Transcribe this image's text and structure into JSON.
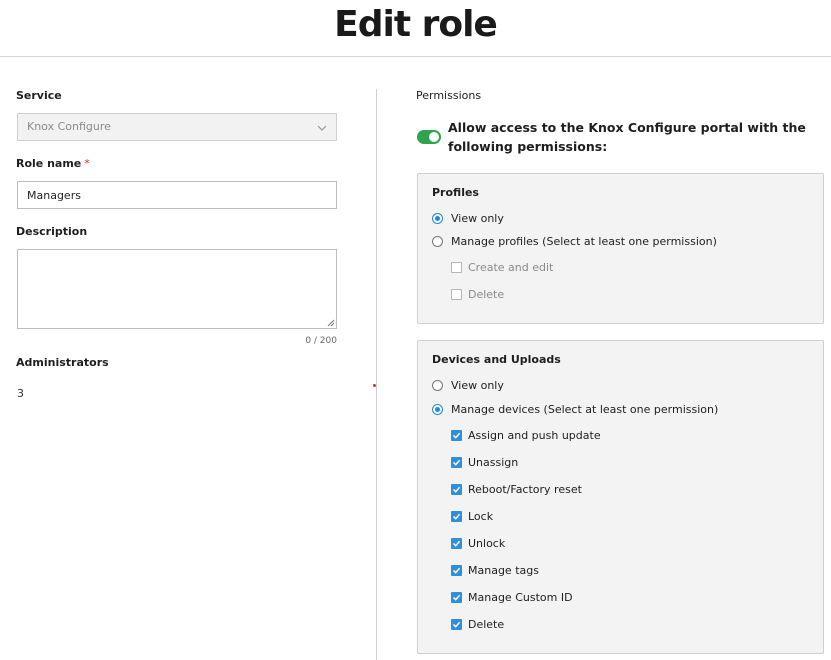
{
  "page": {
    "title": "Edit role"
  },
  "left": {
    "service": {
      "label": "Service",
      "value": "Knox Configure"
    },
    "role_name": {
      "label": "Role name",
      "required_mark": "*",
      "value": "Managers"
    },
    "description": {
      "label": "Description",
      "value": "",
      "counter": "0 / 200"
    },
    "administrators": {
      "label": "Administrators",
      "value": "3"
    }
  },
  "right": {
    "label": "Permissions",
    "toggle": {
      "on": true,
      "text": "Allow access to the Knox Configure portal with the following permissions:"
    },
    "profiles": {
      "title": "Profiles",
      "options": [
        {
          "label": "View only",
          "checked": true
        },
        {
          "label": "Manage profiles (Select at least one permission)",
          "checked": false
        }
      ],
      "permissions": [
        {
          "label": "Create and edit",
          "checked": false,
          "disabled": true
        },
        {
          "label": "Delete",
          "checked": false,
          "disabled": true
        }
      ]
    },
    "devices": {
      "title": "Devices and Uploads",
      "options": [
        {
          "label": "View only",
          "checked": false
        },
        {
          "label": "Manage devices (Select at least one permission)",
          "checked": true
        }
      ],
      "permissions": [
        {
          "label": "Assign and push update",
          "checked": true
        },
        {
          "label": "Unassign",
          "checked": true
        },
        {
          "label": "Reboot/Factory reset",
          "checked": true
        },
        {
          "label": "Lock",
          "checked": true
        },
        {
          "label": "Unlock",
          "checked": true
        },
        {
          "label": "Manage tags",
          "checked": true
        },
        {
          "label": "Manage Custom ID",
          "checked": true
        },
        {
          "label": "Delete",
          "checked": true
        }
      ]
    }
  },
  "colors": {
    "accent": "#1e88e5",
    "toggle_on": "#2ea44f",
    "required": "#d9312b",
    "panel_bg": "#f3f3f3"
  }
}
